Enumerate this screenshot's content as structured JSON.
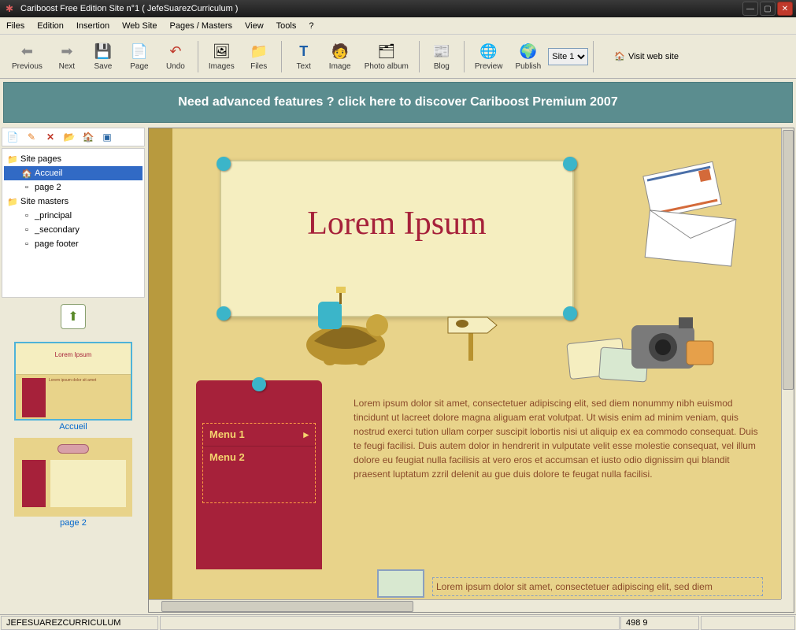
{
  "window": {
    "title": "Cariboost Free Edition Site n°1 ( JefeSuarezCurriculum )"
  },
  "menu": {
    "files": "Files",
    "edition": "Edition",
    "insertion": "Insertion",
    "website": "Web Site",
    "pages": "Pages / Masters",
    "view": "View",
    "tools": "Tools",
    "help": "?"
  },
  "toolbar": {
    "previous": "Previous",
    "next": "Next",
    "save": "Save",
    "page": "Page",
    "undo": "Undo",
    "images": "Images",
    "files": "Files",
    "text": "Text",
    "image": "Image",
    "photo_album": "Photo album",
    "blog": "Blog",
    "preview": "Preview",
    "publish": "Publish",
    "site_value": "Site 1",
    "visit": "Visit web site"
  },
  "promo": {
    "text": "Need advanced features ? click here to discover Cariboost Premium 2007"
  },
  "tree": {
    "site_pages": "Site pages",
    "accueil": "Accueil",
    "page2": "page 2",
    "site_masters": "Site masters",
    "principal": "_principal",
    "secondary": "_secondary",
    "footer": "page footer"
  },
  "thumbs": {
    "t1": "Accueil",
    "t2": "page 2"
  },
  "page": {
    "title": "Lorem Ipsum",
    "menu1": "Menu 1",
    "menu2": "Menu 2",
    "body": "Lorem ipsum dolor sit amet, consectetuer adipiscing elit, sed diem nonummy nibh euismod tincidunt ut lacreet dolore magna aliguam erat volutpat. Ut wisis enim ad minim veniam, quis nostrud exerci tution ullam corper suscipit lobortis nisi ut aliquip ex ea commodo consequat. Duis te feugi facilisi. Duis autem dolor in hendrerit in vulputate velit esse molestie consequat, vel illum dolore eu feugiat nulla facilisis at vero eros et accumsan et iusto odio dignissim qui blandit praesent luptatum zzril delenit au gue duis dolore te feugat nulla facilisi.",
    "body2": "Lorem ipsum dolor sit amet, consectetuer adipiscing elit, sed diem"
  },
  "statusbar": {
    "site": "JEFESUAREZCURRICULUM",
    "coords": "498 9"
  }
}
